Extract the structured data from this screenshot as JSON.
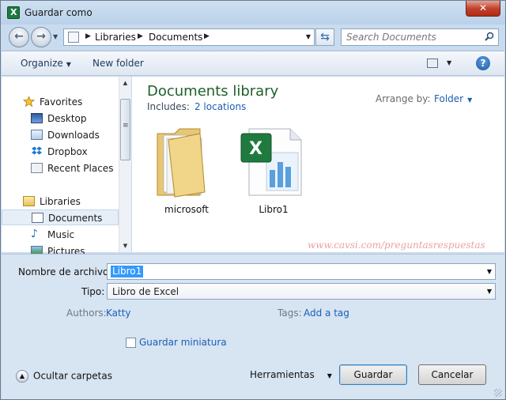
{
  "window": {
    "title": "Guardar como",
    "close_label": "✕",
    "app_icon": "excel-icon"
  },
  "address": {
    "crumbs": [
      "Libraries",
      "Documents"
    ],
    "search_placeholder": "Search Documents"
  },
  "toolbar": {
    "organize_label": "Organize",
    "new_folder_label": "New folder",
    "help_label": "?"
  },
  "nav": {
    "favorites": {
      "label": "Favorites",
      "icon": "star-icon"
    },
    "favorite_items": [
      {
        "label": "Desktop",
        "icon": "desktop-icon"
      },
      {
        "label": "Downloads",
        "icon": "downloads-icon"
      },
      {
        "label": "Dropbox",
        "icon": "dropbox-icon"
      },
      {
        "label": "Recent Places",
        "icon": "recent-places-icon"
      }
    ],
    "libraries": {
      "label": "Libraries",
      "icon": "libraries-icon"
    },
    "library_items": [
      {
        "label": "Documents",
        "icon": "documents-icon",
        "selected": true
      },
      {
        "label": "Music",
        "icon": "music-icon"
      },
      {
        "label": "Pictures",
        "icon": "pictures-icon"
      }
    ]
  },
  "content": {
    "title": "Documents library",
    "includes_label": "Includes:",
    "includes_link": "2 locations",
    "arrange_label": "Arrange by:",
    "arrange_value": "Folder",
    "files": [
      {
        "name": "microsoft",
        "icon": "folder-icon"
      },
      {
        "name": "Libro1",
        "icon": "excel-file-icon"
      }
    ],
    "watermark": "www.cavsi.com/preguntasrespuestas"
  },
  "form": {
    "filename_label": "Nombre de archivo:",
    "filename_value": "Libro1",
    "type_label": "Tipo:",
    "type_value": "Libro de Excel",
    "authors_label": "Authors:",
    "authors_value": "Katty",
    "tags_label": "Tags:",
    "tags_value": "Add a tag",
    "thumbnail_label": "Guardar miniatura",
    "thumbnail_checked": false,
    "hide_folders_label": "Ocultar carpetas",
    "tools_label": "Herramientas",
    "save_label": "Guardar",
    "cancel_label": "Cancelar"
  },
  "colors": {
    "accent_link": "#1a5fb4",
    "library_title": "#1f5f2c",
    "selection": "#3399ff",
    "close": "#c2432d"
  }
}
